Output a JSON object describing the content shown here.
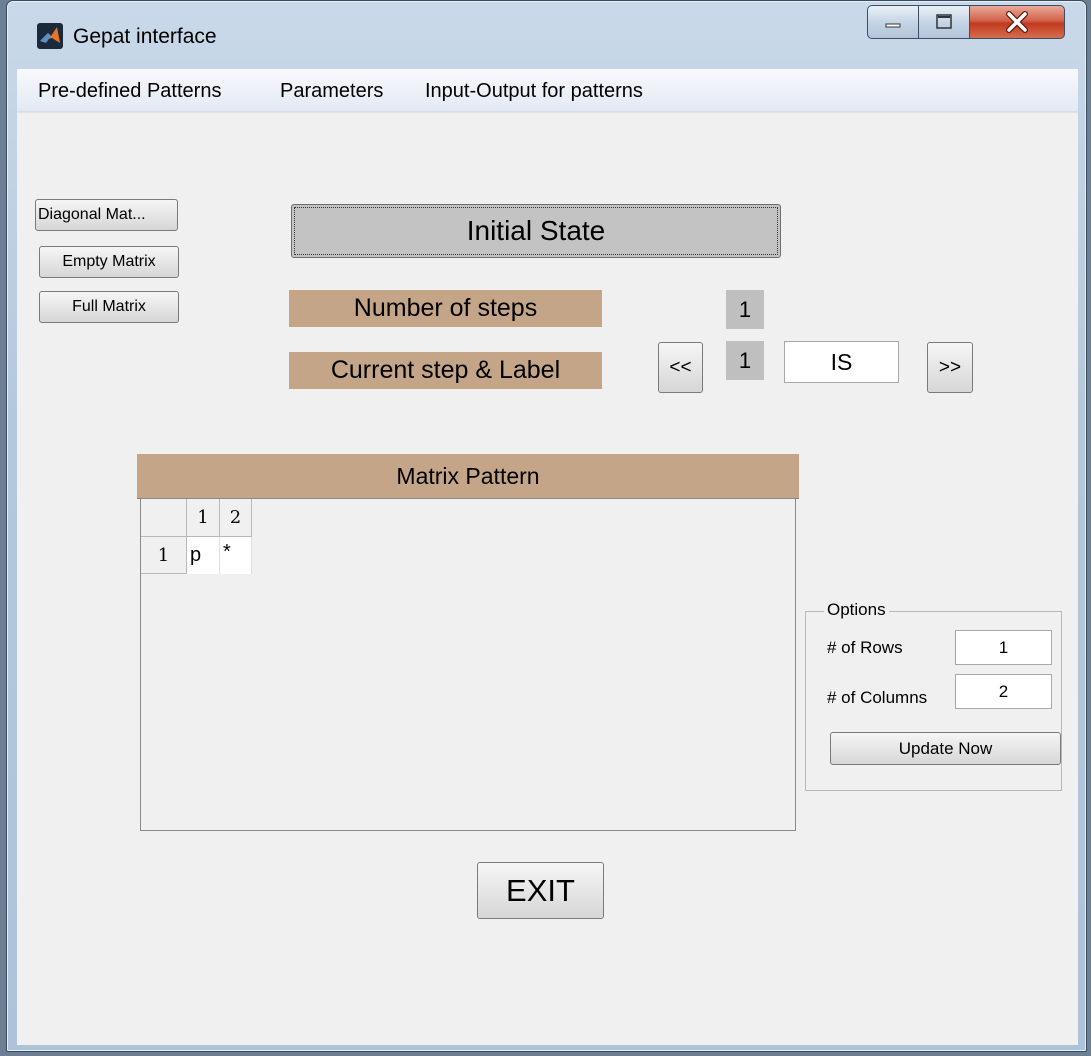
{
  "window": {
    "title": "Gepat interface",
    "controls": {
      "minimize": "minimize-icon",
      "maximize": "maximize-icon",
      "close": "close-icon"
    }
  },
  "menu": [
    "Pre-defined Patterns",
    "Parameters",
    "Input-Output for patterns"
  ],
  "left_buttons": [
    "Diagonal Mat...",
    "Empty Matrix",
    "Full Matrix"
  ],
  "state_button": "Initial State",
  "steps": {
    "number_label": "Number of steps",
    "number_value": "1",
    "current_label": "Current step & Label",
    "prev_label": "<<",
    "current_value": "1",
    "label_value": "IS",
    "next_label": ">>"
  },
  "matrix": {
    "title": "Matrix Pattern",
    "col_headers": [
      "1",
      "2"
    ],
    "rows": [
      {
        "header": "1",
        "cells": [
          "p",
          "*"
        ]
      }
    ]
  },
  "options": {
    "legend": "Options",
    "rows_label": "# of Rows",
    "rows_value": "1",
    "cols_label": "# of Columns",
    "cols_value": "2",
    "update_label": "Update Now"
  },
  "exit_label": "EXIT",
  "colors": {
    "tan_label": "#c4a588",
    "value_box": "#bfbfbf",
    "client_bg": "#f0f0f0"
  }
}
